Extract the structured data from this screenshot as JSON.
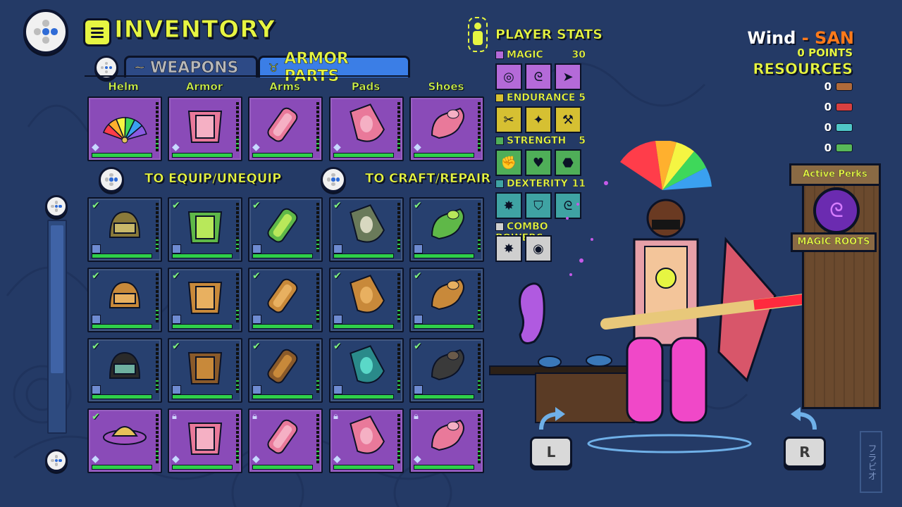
{
  "header": {
    "title": "INVENTORY"
  },
  "tabs": [
    {
      "label": "WEAPONS",
      "active": false
    },
    {
      "label": "ARMOR PARTS",
      "active": true
    }
  ],
  "columns": [
    "Helm",
    "Armor",
    "Arms",
    "Pads",
    "Shoes"
  ],
  "hints": {
    "equip": "TO EQUIP/UNEQUIP",
    "craft": "TO CRAFT/REPAIR"
  },
  "equipped_row": [
    {
      "item": "rainbow-fan-helm",
      "bg": "purple"
    },
    {
      "item": "pink-vest",
      "bg": "purple"
    },
    {
      "item": "pink-gauntlet",
      "bg": "purple"
    },
    {
      "item": "pink-pad",
      "bg": "purple"
    },
    {
      "item": "pink-shoe",
      "bg": "purple"
    }
  ],
  "grid_rows": [
    [
      {
        "item": "samurai-helm",
        "state": "checked"
      },
      {
        "item": "green-chest",
        "state": "checked"
      },
      {
        "item": "green-arm",
        "state": "checked"
      },
      {
        "item": "bandage-pad",
        "state": "checked"
      },
      {
        "item": "green-boot",
        "state": "checked"
      }
    ],
    [
      {
        "item": "wood-helm",
        "state": "checked"
      },
      {
        "item": "wood-chest",
        "state": "checked"
      },
      {
        "item": "wood-arm",
        "state": "checked"
      },
      {
        "item": "wood-pad",
        "state": "checked"
      },
      {
        "item": "wood-boot",
        "state": "checked"
      }
    ],
    [
      {
        "item": "kendo-helm",
        "state": "checked"
      },
      {
        "item": "bronze-chest",
        "state": "checked"
      },
      {
        "item": "bronze-arm",
        "state": "checked"
      },
      {
        "item": "teal-pad",
        "state": "checked"
      },
      {
        "item": "dark-boot",
        "state": "checked"
      }
    ],
    [
      {
        "item": "straw-hat",
        "state": "checked"
      },
      {
        "item": "pink-vest",
        "state": "locked"
      },
      {
        "item": "pink-gauntlet",
        "state": "locked"
      },
      {
        "item": "pink-pad",
        "state": "locked"
      },
      {
        "item": "pink-shoe",
        "state": "locked"
      }
    ]
  ],
  "player_stats": {
    "title": "PLAYER STATS",
    "stats": [
      {
        "name": "MAGIC",
        "value": "30",
        "color": "#b46ad8",
        "icons": [
          "swirl-icon",
          "magic-plus-icon",
          "arrow-burst-icon"
        ]
      },
      {
        "name": "ENDURANCE",
        "value": "5",
        "color": "#d6c032",
        "icons": [
          "dash-icon",
          "run-icon",
          "wrench-icon"
        ]
      },
      {
        "name": "STRENGTH",
        "value": "5",
        "color": "#4fae58",
        "icons": [
          "fist-icon",
          "heart-plus-icon",
          "weight-plus-icon"
        ]
      },
      {
        "name": "DEXTERITY",
        "value": "11",
        "color": "#3fa3a3",
        "icons": [
          "strike-icon",
          "shield-icon",
          "spiral-icon"
        ]
      },
      {
        "name": "COMBO POWERS",
        "value": "",
        "color": "#cfcfcf",
        "icons": [
          "combo-slam-icon",
          "combo-spin-icon"
        ]
      }
    ]
  },
  "character": {
    "name": "Wind",
    "separator": " - ",
    "style": "SAN",
    "points": "0 POINTS"
  },
  "resources": {
    "title": "RESOURCES",
    "items": [
      {
        "count": "0",
        "icon": "wood-icon",
        "color": "#b06a3a"
      },
      {
        "count": "0",
        "icon": "red-ore-icon",
        "color": "#d84040"
      },
      {
        "count": "0",
        "icon": "teal-ore-icon",
        "color": "#4fc7c7"
      },
      {
        "count": "0",
        "icon": "green-ore-icon",
        "color": "#58b858"
      }
    ]
  },
  "perks": {
    "title": "Active Perks",
    "name": "MAGIC ROOTS"
  },
  "shoulder_buttons": {
    "left": "L",
    "right": "R"
  },
  "corner_sign": "フラビオ",
  "colors": {
    "accent": "#e6f542",
    "orange": "#ff7a1a",
    "bg": "#243a66"
  }
}
